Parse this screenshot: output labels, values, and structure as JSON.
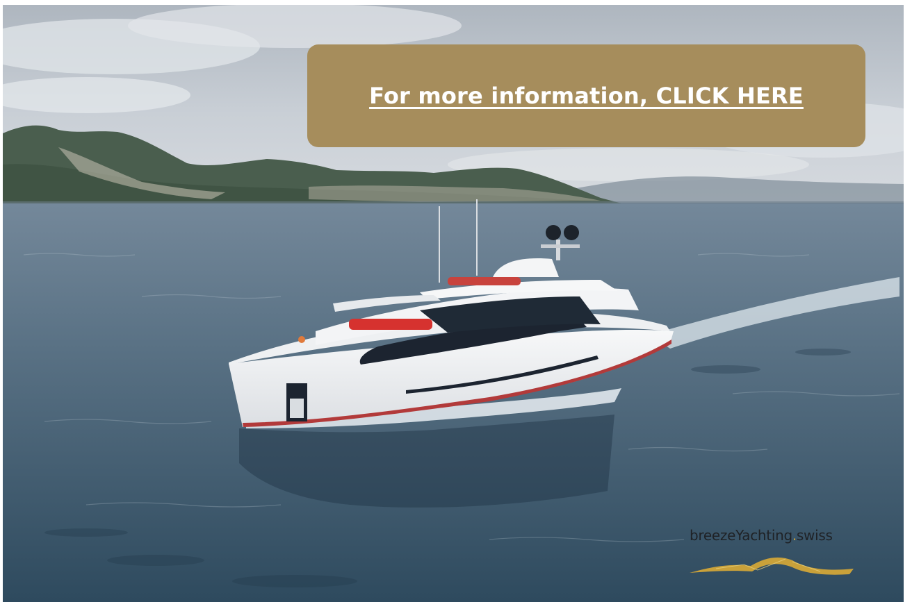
{
  "banner": {
    "cta_text": "For more information, CLICK HERE",
    "cta_color": "#a68d5c",
    "cta_text_color": "#ffffff"
  },
  "brand": {
    "name_part1": "breezeYachting",
    "name_dot": ".",
    "name_part2": "swiss",
    "wave_color": "#c9a13a"
  },
  "scene": {
    "subject": "yacht-photo",
    "sea_color": "#3e5566",
    "sky_color": "#c9cfd6"
  }
}
